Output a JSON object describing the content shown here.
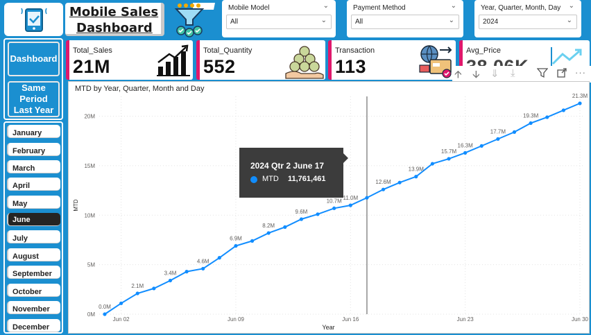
{
  "header": {
    "title_line1": "Mobile Sales",
    "title_line2": "Dashboard"
  },
  "slicers": [
    {
      "label": "Mobile Model",
      "value": "All"
    },
    {
      "label": "Payment Method",
      "value": "All"
    },
    {
      "label": "Year, Quarter, Month, Day",
      "value": "2024"
    }
  ],
  "nav": {
    "dashboard": "Dashboard",
    "same_period": "Same Period Last Year"
  },
  "kpis": [
    {
      "label": "Total_Sales",
      "value": "21M",
      "icon": "bar-chart-growth-icon"
    },
    {
      "label": "Total_Quantity",
      "value": "552",
      "icon": "money-bags-hand-icon"
    },
    {
      "label": "Transaction",
      "value": "113",
      "icon": "online-payment-icon"
    },
    {
      "label": "Avg_Price",
      "value": "38.06K",
      "icon": "trend-chart-icon"
    }
  ],
  "months": [
    "January",
    "February",
    "March",
    "April",
    "May",
    "June",
    "July",
    "August",
    "September",
    "October",
    "November",
    "December"
  ],
  "selected_month": "June",
  "toolbar": {
    "icons": [
      "drill-up-icon",
      "drill-down-icon",
      "expand-all-down-icon",
      "expand-next-level-icon",
      "filter-icon",
      "focus-mode-icon",
      "more-options-icon"
    ]
  },
  "tooltip": {
    "title": "2024 Qtr 2 June 17",
    "series": "MTD",
    "value": "11,761,461"
  },
  "colors": {
    "background": "#1b8fd0",
    "accent": "#e0186c",
    "line": "#118dff",
    "tooltip_bg": "#3c3c3c",
    "selected_month_bg": "#252423"
  },
  "chart_data": {
    "type": "line",
    "title": "MTD by Year, Quarter, Month and Day",
    "xlabel": "Year",
    "ylabel": "MTD",
    "ylim": [
      0,
      22000000
    ],
    "yticks": [
      0,
      5000000,
      10000000,
      15000000,
      20000000
    ],
    "ytick_labels": [
      "0M",
      "5M",
      "10M",
      "15M",
      "20M"
    ],
    "xticks": [
      "Jun 02",
      "Jun 09",
      "Jun 16",
      "Jun 23",
      "Jun 30"
    ],
    "xtick_days": [
      2,
      9,
      16,
      23,
      30
    ],
    "grid": true,
    "series": [
      {
        "name": "MTD",
        "x": [
          1,
          2,
          3,
          4,
          5,
          6,
          7,
          8,
          9,
          10,
          11,
          12,
          13,
          14,
          15,
          16,
          17,
          18,
          19,
          20,
          21,
          22,
          23,
          24,
          25,
          26,
          27,
          28,
          29,
          30
        ],
        "values": [
          0.0,
          1.1,
          2.1,
          2.6,
          3.4,
          4.3,
          4.6,
          5.7,
          6.9,
          7.4,
          8.2,
          8.8,
          9.6,
          10.1,
          10.7,
          11.0,
          11.76,
          12.6,
          13.3,
          13.9,
          15.2,
          15.7,
          16.3,
          17.0,
          17.7,
          18.4,
          19.3,
          19.9,
          20.6,
          21.3
        ],
        "labels": {
          "1": "0.0M",
          "3": "2.1M",
          "5": "3.4M",
          "7": "4.6M",
          "9": "6.9M",
          "11": "8.2M",
          "13": "9.6M",
          "15": "10.7M",
          "16": "11.0M",
          "18": "12.6M",
          "20": "13.9M",
          "22": "15.7M",
          "23": "16.3M",
          "25": "17.7M",
          "27": "19.3M",
          "30": "21.3M"
        }
      }
    ],
    "highlight_day": 17
  }
}
